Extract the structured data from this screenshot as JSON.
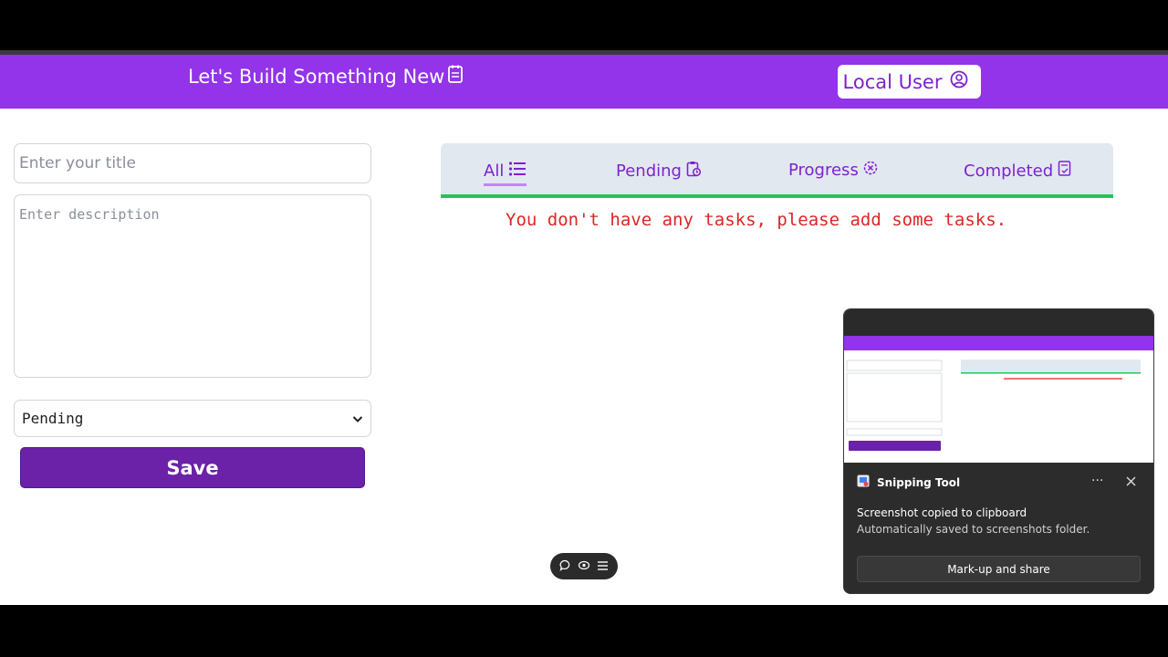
{
  "app": {
    "brand_title": "Let's Build Something New",
    "user_label": "Local User"
  },
  "form": {
    "title_placeholder": "Enter your title",
    "title_value": "",
    "description_placeholder": "Enter description",
    "description_value": "",
    "status_selected": "Pending",
    "save_label": "Save"
  },
  "tabs": [
    {
      "label": "All",
      "icon": "list-icon",
      "active": true
    },
    {
      "label": "Pending",
      "icon": "clipboard-clock-icon"
    },
    {
      "label": "Progress",
      "icon": "circle-x-icon"
    },
    {
      "label": "Completed",
      "icon": "document-check-icon"
    }
  ],
  "empty_message": "You don't have any tasks, please add some tasks.",
  "toast": {
    "app_name": "Snipping Tool",
    "title": "Screenshot copied to clipboard",
    "subtitle": "Automatically saved to screenshots folder.",
    "action_label": "Mark-up and share",
    "more_label": "···"
  },
  "colors": {
    "navbar": "#9333ea",
    "accent_text": "#7e22ce",
    "save_button": "#6b21a8",
    "tabs_bg": "#e2e8f0",
    "tabs_border": "#22c55e",
    "error_text": "#dc2626"
  }
}
